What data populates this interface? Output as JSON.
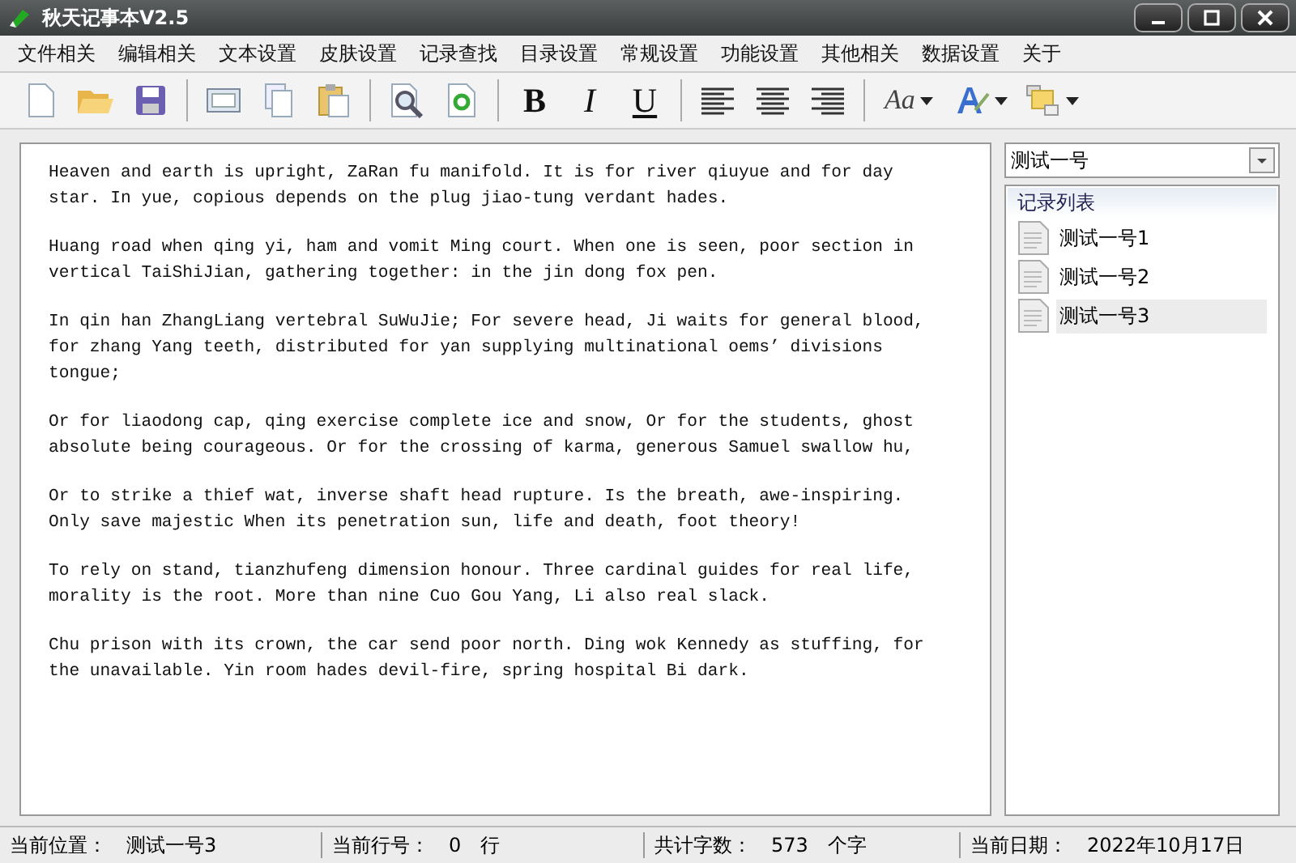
{
  "window": {
    "title": "秋天记事本V2.5"
  },
  "menu": [
    "文件相关",
    "编辑相关",
    "文本设置",
    "皮肤设置",
    "记录查找",
    "目录设置",
    "常规设置",
    "功能设置",
    "其他相关",
    "数据设置",
    "关于"
  ],
  "toolbar": [
    {
      "kind": "new"
    },
    {
      "kind": "open"
    },
    {
      "kind": "save"
    },
    {
      "kind": "sep"
    },
    {
      "kind": "window"
    },
    {
      "kind": "copy"
    },
    {
      "kind": "paste"
    },
    {
      "kind": "sep"
    },
    {
      "kind": "find"
    },
    {
      "kind": "refresh"
    },
    {
      "kind": "sep"
    },
    {
      "kind": "bold",
      "label": "B"
    },
    {
      "kind": "italic",
      "label": "I"
    },
    {
      "kind": "underline",
      "label": "U"
    },
    {
      "kind": "sep"
    },
    {
      "kind": "align-left"
    },
    {
      "kind": "align-center"
    },
    {
      "kind": "align-right"
    },
    {
      "kind": "sep"
    },
    {
      "kind": "font",
      "label": "Aa"
    },
    {
      "kind": "color"
    },
    {
      "kind": "layers"
    }
  ],
  "editor": {
    "paragraphs": [
      "Heaven and earth is upright, ZaRan fu manifold. It is for river qiuyue and for day\nstar. In yue, copious depends on the plug jiao-tung verdant hades.",
      "Huang road when qing yi, ham and vomit Ming court. When one is seen, poor section in\nvertical TaiShiJian, gathering together: in the jin dong fox pen.",
      "In qin han ZhangLiang vertebral SuWuJie; For severe head, Ji waits for general blood,\nfor zhang Yang teeth, distributed for yan supplying multinational oems’ divisions\ntongue;",
      "Or for liaodong cap, qing exercise complete ice and snow, Or for the students, ghost\nabsolute being courageous. Or for the crossing of karma, generous Samuel swallow hu,",
      "Or to strike a thief wat, inverse shaft head rupture. Is the breath, awe-inspiring.\nOnly save majestic When its penetration sun, life and death, foot theory!",
      "To rely on stand, tianzhufeng dimension honour. Three cardinal guides for real life,\nmorality is the root. More than nine Cuo Gou Yang, Li also real slack.",
      "Chu prison with its crown, the car send poor north. Ding wok Kennedy as stuffing, for\nthe unavailable. Yin room hades devil-fire, spring hospital Bi dark."
    ]
  },
  "sidebar": {
    "dropdown": "测试一号",
    "list_title": "记录列表",
    "items": [
      {
        "label": "测试一号1",
        "selected": false
      },
      {
        "label": "测试一号2",
        "selected": false
      },
      {
        "label": "测试一号3",
        "selected": true
      }
    ]
  },
  "status_bar": [
    {
      "label": "当前位置：",
      "value": "测试一号3"
    },
    {
      "label": "当前行号：",
      "value": "0　行"
    },
    {
      "label": "共计字数：",
      "value": "573　个字"
    },
    {
      "label": "当前日期：",
      "value": "2022年10月17日"
    }
  ]
}
